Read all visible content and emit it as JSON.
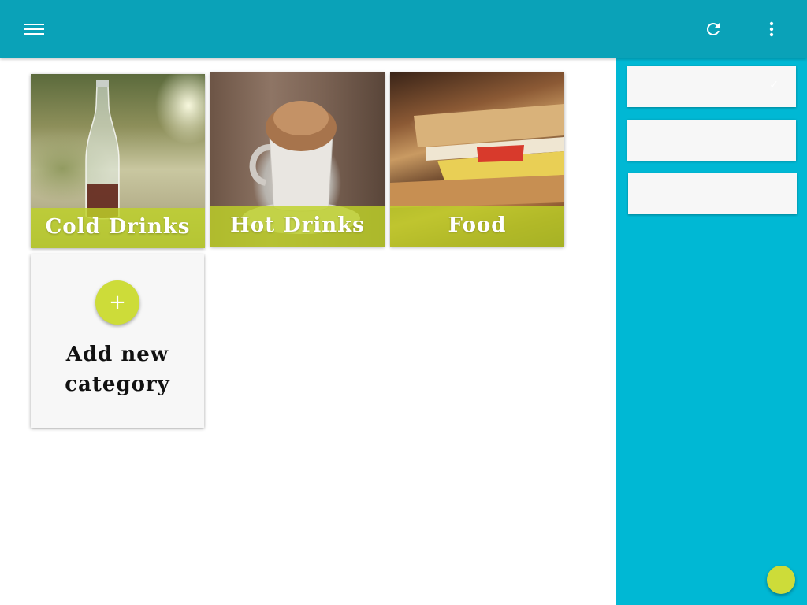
{
  "app_bar": {
    "menu_icon": "hamburger-menu-icon",
    "refresh_icon": "refresh-icon",
    "overflow_icon": "more-vert-icon",
    "background_color": "#0aa2b8"
  },
  "categories": [
    {
      "label": "Cold Drinks",
      "image": "cola-bottle-photo"
    },
    {
      "label": "Hot Drinks",
      "image": "hot-chocolate-photo"
    },
    {
      "label": "Food",
      "image": "sandwich-photo"
    }
  ],
  "add_category": {
    "label_line1": "Add new",
    "label_line2": "category",
    "button_symbol": "+"
  },
  "side_panel": {
    "background_color": "#00b8d4",
    "cards": [
      {
        "check": "✓"
      },
      {},
      {}
    ]
  },
  "colors": {
    "accent": "#cddc39",
    "caption_band": "#bed228"
  }
}
